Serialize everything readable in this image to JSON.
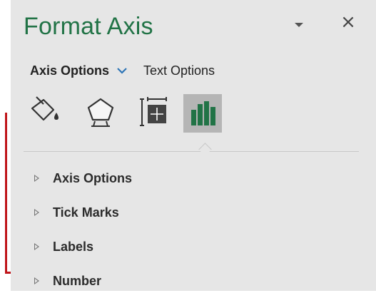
{
  "pane": {
    "title": "Format Axis",
    "title_color": "#217346",
    "close_glyph": "×"
  },
  "options": {
    "active_label": "Axis Options",
    "chevron_color": "#2e75b6",
    "text_label": "Text Options"
  },
  "icon_tabs": [
    {
      "name": "fill-line-icon",
      "selected": false
    },
    {
      "name": "effects-pentagon-icon",
      "selected": false
    },
    {
      "name": "size-properties-icon",
      "selected": false
    },
    {
      "name": "axis-options-bars-icon",
      "selected": true,
      "color": "#217346"
    }
  ],
  "sections": [
    {
      "label": "Axis Options"
    },
    {
      "label": "Tick Marks"
    },
    {
      "label": "Labels"
    },
    {
      "label": "Number"
    }
  ],
  "annotation_color": "#c0161b"
}
